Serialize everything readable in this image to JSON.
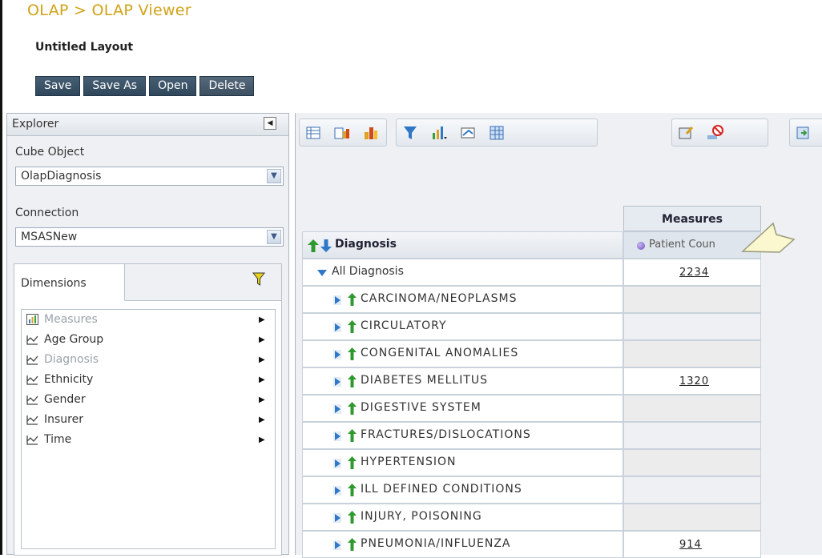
{
  "breadcrumb": "OLAP > OLAP Viewer",
  "layout_title": "Untitled Layout",
  "actions": {
    "save": "Save",
    "save_as": "Save As",
    "open": "Open",
    "delete": "Delete"
  },
  "explorer": {
    "title": "Explorer",
    "collapse_glyph": "◀",
    "cube_label": "Cube Object",
    "cube_value": "OlapDiagnosis",
    "connection_label": "Connection",
    "connection_value": "MSASNew",
    "dimensions_tab": "Dimensions",
    "dimensions": [
      {
        "label": "Measures",
        "icon": "measures-icon",
        "disabled": true
      },
      {
        "label": "Age Group",
        "icon": "hierarchy-icon",
        "disabled": false
      },
      {
        "label": "Diagnosis",
        "icon": "hierarchy-icon",
        "disabled": true
      },
      {
        "label": "Ethnicity",
        "icon": "hierarchy-icon",
        "disabled": false
      },
      {
        "label": "Gender",
        "icon": "hierarchy-icon",
        "disabled": false
      },
      {
        "label": "Insurer",
        "icon": "hierarchy-icon",
        "disabled": false
      },
      {
        "label": "Time",
        "icon": "hierarchy-icon",
        "disabled": false
      }
    ]
  },
  "grid": {
    "measures_header": "Measures",
    "row_header": "Diagnosis",
    "column_header": "Patient Coun",
    "all_label": "All Diagnosis",
    "all_value": "2234",
    "rows": [
      {
        "label": "CARCINOMA/NEOPLASMS",
        "value": ""
      },
      {
        "label": "CIRCULATORY",
        "value": ""
      },
      {
        "label": "CONGENITAL ANOMALIES",
        "value": ""
      },
      {
        "label": "DIABETES MELLITUS",
        "value": "1320"
      },
      {
        "label": "DIGESTIVE SYSTEM",
        "value": ""
      },
      {
        "label": "FRACTURES/DISLOCATIONS",
        "value": ""
      },
      {
        "label": "HYPERTENSION",
        "value": ""
      },
      {
        "label": "ILL DEFINED CONDITIONS",
        "value": ""
      },
      {
        "label": "INJURY, POISONING",
        "value": ""
      },
      {
        "label": "PNEUMONIA/INFLUENZA",
        "value": "914"
      }
    ]
  },
  "colors": {
    "accent_gold": "#d1a216",
    "button_dark": "#30475b",
    "grid_alt": "#ececec"
  }
}
